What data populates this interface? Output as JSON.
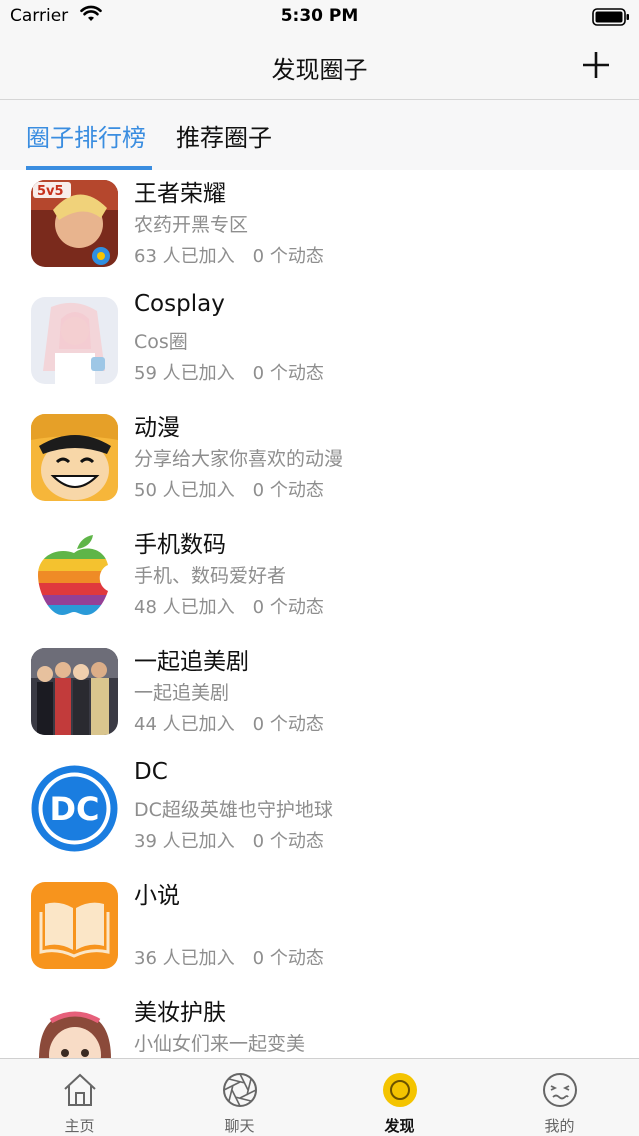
{
  "status_bar": {
    "carrier": "Carrier",
    "time": "5:30 PM"
  },
  "nav": {
    "title": "发现圈子",
    "add_icon": "plus-icon"
  },
  "tabs": [
    {
      "label": "圈子排行榜",
      "active": true
    },
    {
      "label": "推荐圈子",
      "active": false
    }
  ],
  "circles": [
    {
      "name": "王者荣耀",
      "desc": "农药开黑专区",
      "members": "63 人已加入",
      "posts": "0 个动态",
      "icon": "game-hero-avatar"
    },
    {
      "name": "Cosplay",
      "desc": "Cos圈",
      "members": "59 人已加入",
      "posts": "0 个动态",
      "icon": "cosplay-avatar"
    },
    {
      "name": "动漫",
      "desc": "分享给大家你喜欢的动漫",
      "members": "50 人已加入",
      "posts": "0 个动态",
      "icon": "anime-face-avatar"
    },
    {
      "name": "手机数码",
      "desc": "手机、数码爱好者",
      "members": "48 人已加入",
      "posts": "0 个动态",
      "icon": "rainbow-apple-avatar"
    },
    {
      "name": "一起追美剧",
      "desc": "一起追美剧",
      "members": "44 人已加入",
      "posts": "0 个动态",
      "icon": "tv-cast-avatar"
    },
    {
      "name": "DC",
      "desc": "DC超级英雄也守护地球",
      "members": "39 人已加入",
      "posts": "0 个动态",
      "icon": "dc-logo-avatar"
    },
    {
      "name": "小说",
      "desc": "",
      "members": "36 人已加入",
      "posts": "0 个动态",
      "icon": "open-book-avatar"
    },
    {
      "name": "美妆护肤",
      "desc": "小仙女们来一起变美",
      "members": "",
      "posts": "",
      "icon": "cartoon-girl-avatar"
    }
  ],
  "tab_bar": [
    {
      "label": "主页",
      "icon": "home-icon",
      "active": false
    },
    {
      "label": "聊天",
      "icon": "aperture-icon",
      "active": false
    },
    {
      "label": "发现",
      "icon": "discover-circle-icon",
      "active": true
    },
    {
      "label": "我的",
      "icon": "face-icon",
      "active": false
    }
  ],
  "colors": {
    "accent": "#3a8de0",
    "active_tab": "#f4c400",
    "secondary_text": "#8e8e8e"
  }
}
